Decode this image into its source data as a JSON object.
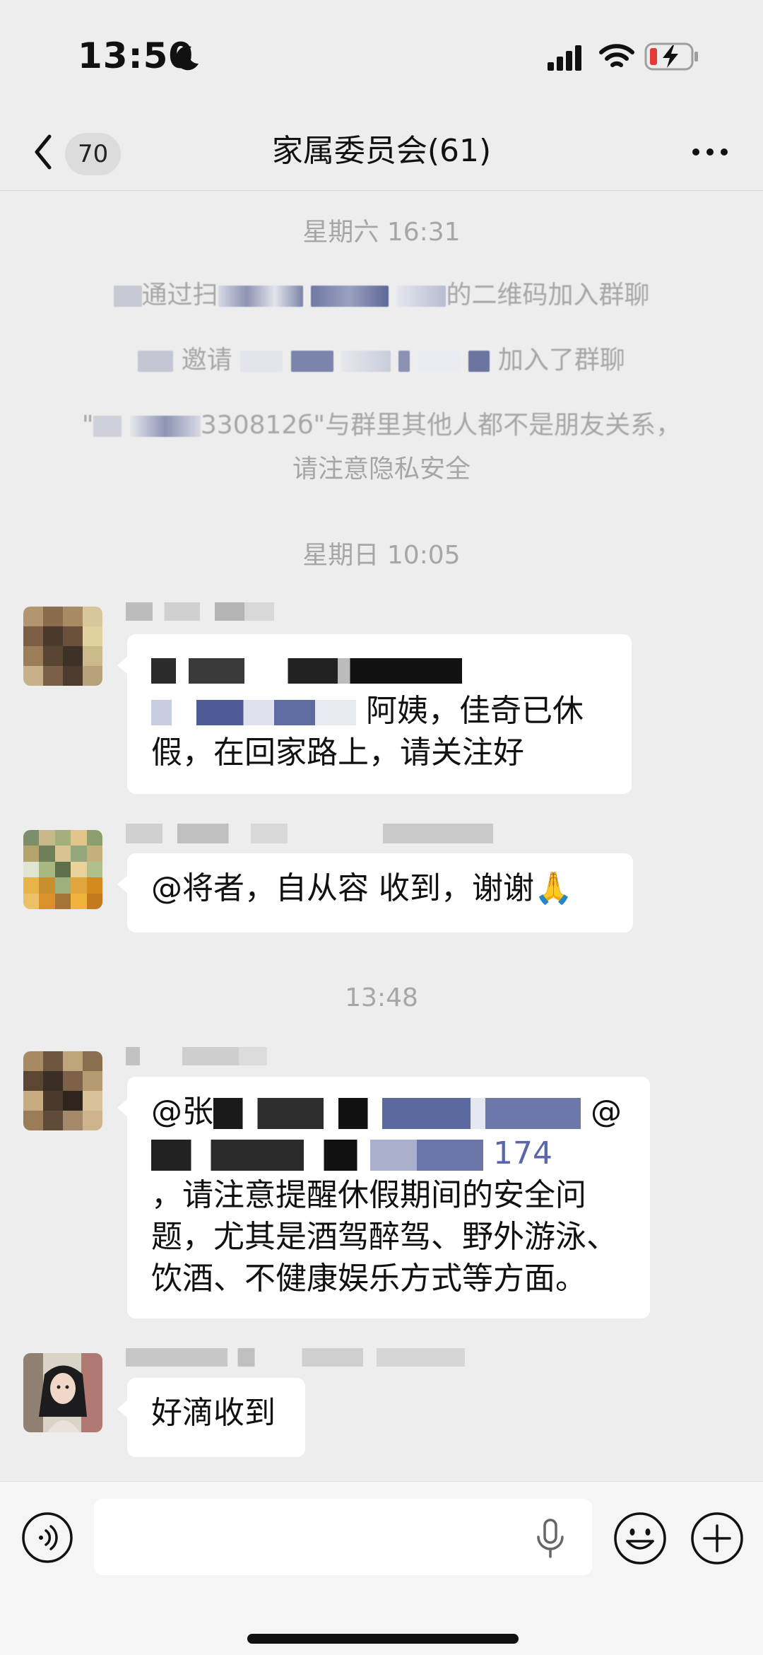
{
  "status_bar": {
    "time": "13:50"
  },
  "nav": {
    "unread_count": "70",
    "title": "家属委员会(61)"
  },
  "messages": {
    "time_1": "星期六 16:31",
    "sys_join_qr_suffix": "的二维码加入群聊",
    "sys_join_qr_mid": "通过扫",
    "sys_invite_mid": "邀请",
    "sys_invite_suffix": "加入了群聊",
    "sys_privacy_line1_code": "330812б",
    "sys_privacy_line1_suffix": "\"与群里其他人都不是朋友关系，",
    "sys_privacy_line2": "请注意隐私安全",
    "time_2": "星期日 10:05",
    "msg1_line2_text": "阿姨，佳奇已休",
    "msg1_line3": "假，在回家路上，请关注好",
    "msg2_text": "@将者，自从容  收到，谢谢🙏",
    "time_3": "13:48",
    "msg3_line1_prefix": "@张",
    "msg3_line1_suffix": "@",
    "msg3_line2_suffix": "174",
    "msg3_line3": "，请注意提醒休假期间的安全问",
    "msg3_line4": "题，尤其是酒驾醉驾、野外游泳、",
    "msg3_line5": "饮酒、不健康娱乐方式等方面。",
    "msg4_text": "好滴收到"
  },
  "icons": {
    "moon": "moon-icon",
    "signal": "signal-icon",
    "wifi": "wifi-icon",
    "battery": "battery-charging-icon",
    "back": "chevron-left-icon",
    "more": "more-icon",
    "voice": "voice-icon",
    "mic": "microphone-icon",
    "emoji": "emoji-icon",
    "add": "plus-icon"
  },
  "colors": {
    "background": "#ededed",
    "bubble": "#ffffff",
    "system_text": "#a6a6a6",
    "battery_low": "#e53935"
  }
}
